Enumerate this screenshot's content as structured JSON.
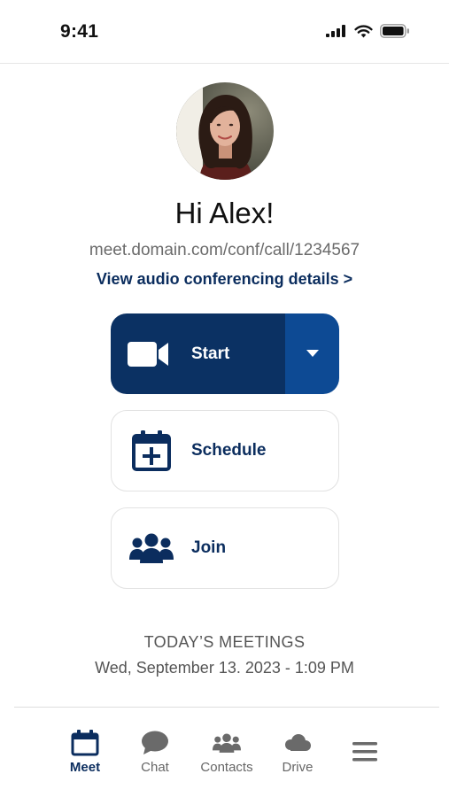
{
  "status_bar": {
    "time": "9:41"
  },
  "profile": {
    "greeting": "Hi Alex!",
    "meeting_url": "meet.domain.com/conf/call/1234567",
    "audio_link": "View audio conferencing details >"
  },
  "actions": {
    "start_label": "Start",
    "schedule_label": "Schedule",
    "join_label": "Join"
  },
  "meetings": {
    "heading": "TODAY’S MEETINGS",
    "datetime": "Wed, September 13. 2023 - 1:09 PM"
  },
  "tabs": [
    {
      "label": "Meet",
      "icon": "calendar-icon",
      "active": true
    },
    {
      "label": "Chat",
      "icon": "chat-bubble-icon"
    },
    {
      "label": "Contacts",
      "icon": "people-icon"
    },
    {
      "label": "Drive",
      "icon": "cloud-icon"
    },
    {
      "label": "",
      "icon": "hamburger-menu-icon"
    }
  ],
  "colors": {
    "primary_navy": "#0b3163",
    "dropdown_blue": "#0d4a94",
    "text_navy": "#0b2d5e",
    "tab_icon_gray": "#6a6a6a"
  }
}
